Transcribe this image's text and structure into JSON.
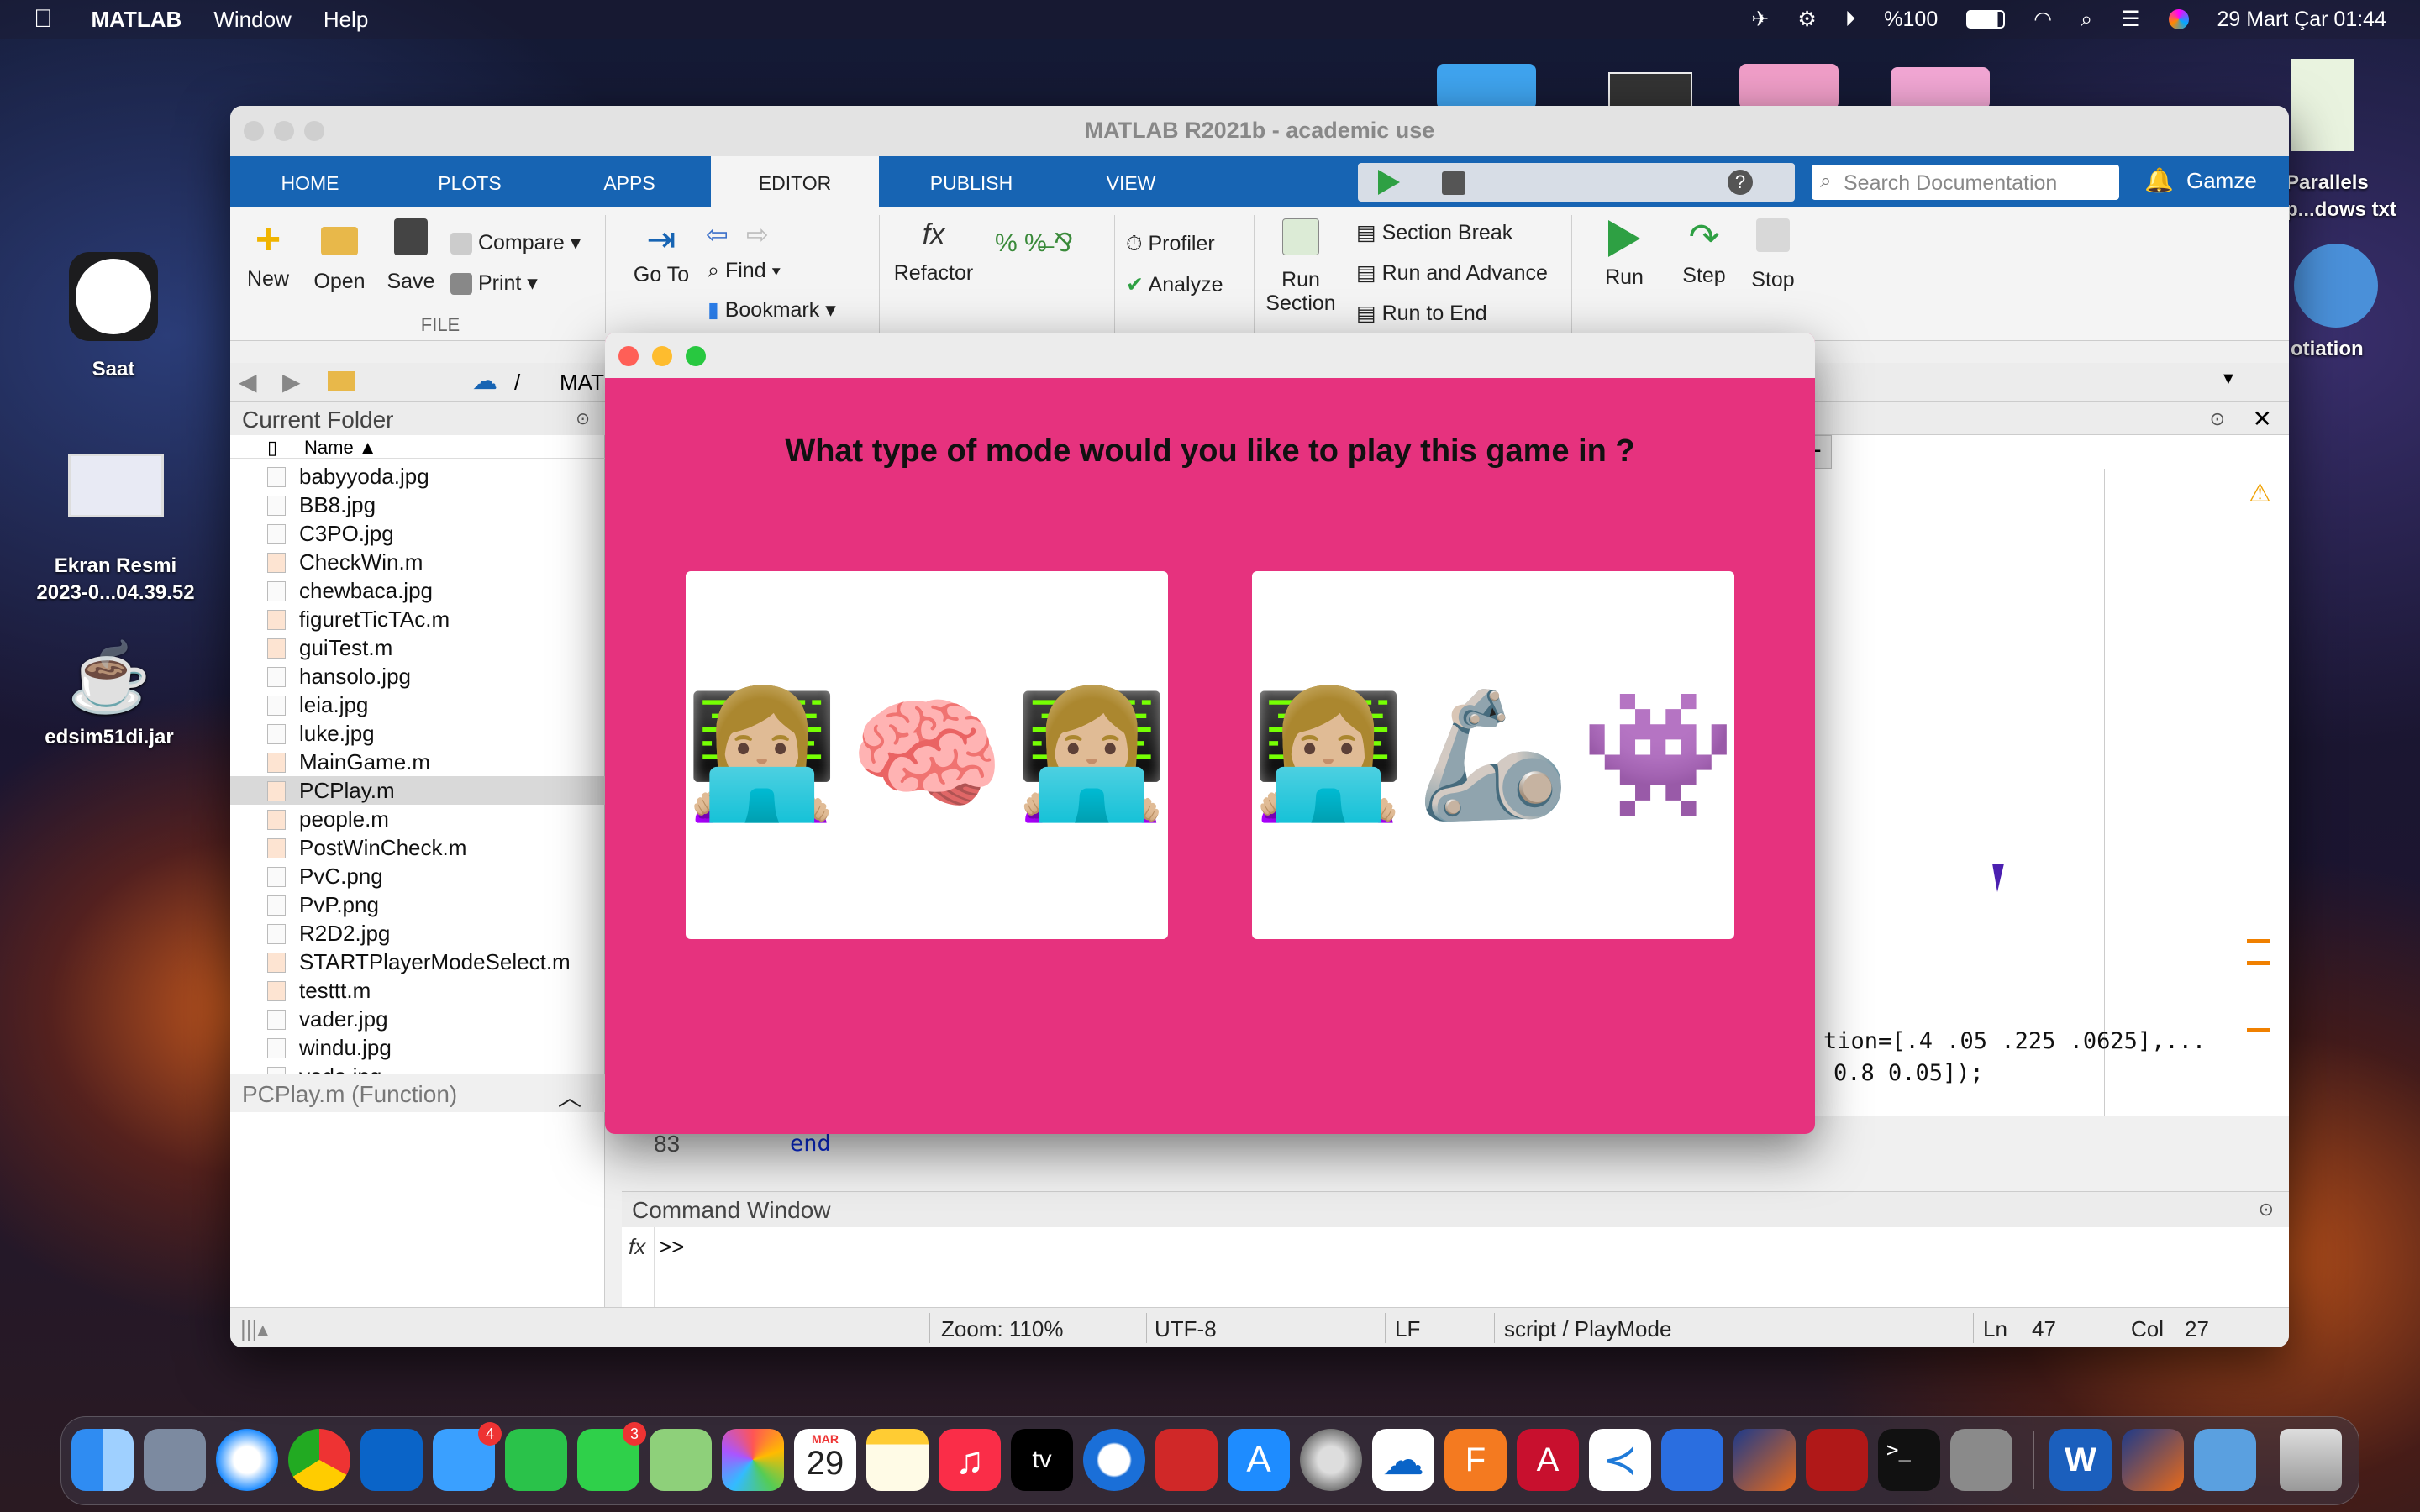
{
  "menubar": {
    "app": "MATLAB",
    "items": [
      "Window",
      "Help"
    ],
    "battery": "%100",
    "datetime": "29 Mart Çar 01:44"
  },
  "desktop": {
    "icons": [
      {
        "label": "Saat"
      },
      {
        "label": "Ekran Resmi\n2023-0...04.39.52"
      },
      {
        "label": "edsim51di.jar"
      },
      {
        "label": "Parallels\np...dows txt"
      },
      {
        "label": "otiation"
      }
    ]
  },
  "window": {
    "title": "MATLAB R2021b - academic use",
    "tabs": [
      "HOME",
      "PLOTS",
      "APPS",
      "EDITOR",
      "PUBLISH",
      "VIEW"
    ],
    "search_placeholder": "Search Documentation",
    "user": "Gamze",
    "ribbon": {
      "new": "New",
      "open": "Open",
      "save": "Save",
      "compare": "Compare",
      "print": "Print",
      "file_section": "FILE",
      "goto": "Go To",
      "find": "Find",
      "bookmark": "Bookmark",
      "refactor": "Refactor",
      "profiler": "Profiler",
      "analyze": "Analyze",
      "run_section": "Run\nSection",
      "section_break": "Section Break",
      "run_advance": "Run and Advance",
      "run_end": "Run to End",
      "run": "Run",
      "step": "Step",
      "stop": "Stop"
    },
    "path": {
      "sep": "/",
      "seg": "MAT"
    },
    "current_folder": {
      "title": "Current Folder",
      "name_header": "Name ▲",
      "files": [
        "babyyoda.jpg",
        "BB8.jpg",
        "C3PO.jpg",
        "CheckWin.m",
        "chewbaca.jpg",
        "figuretTicTAc.m",
        "guiTest.m",
        "hansolo.jpg",
        "leia.jpg",
        "luke.jpg",
        "MainGame.m",
        "PCPlay.m",
        "people.m",
        "PostWinCheck.m",
        "PvC.png",
        "PvP.png",
        "R2D2.jpg",
        "STARTPlayerModeSelect.m",
        "testtt.m",
        "vader.jpg",
        "windu.jpg",
        "yoda.jpg"
      ],
      "selected": "PCPlay.m",
      "footer": "PCPlay.m  (Function)"
    },
    "editor": {
      "code1": "tion=[.4 .05 .225 .0625],...",
      "code2": "0.8 0.05]);",
      "line_no": "83",
      "line_code": "end",
      "plus": "+"
    },
    "command": {
      "title": "Command Window",
      "fx": "fx",
      "prompt": ">>"
    },
    "status": {
      "zoom": "Zoom: 110%",
      "enc": "UTF-8",
      "eol": "LF",
      "ctx": "script / PlayMode",
      "ln_label": "Ln",
      "ln": "47",
      "col_label": "Col",
      "col": "27"
    }
  },
  "dialog": {
    "question": "What type of mode would you like to play this game in ?",
    "pvp": {
      "left": "👩🏼‍💻",
      "mid": "🧠",
      "right": "👩🏼‍💻"
    },
    "pvc": {
      "left": "👩🏼‍💻",
      "mid": "🦾",
      "right": "👾"
    }
  },
  "dock": {
    "calendar_month": "MAR",
    "calendar_day": "29",
    "mail_badge": "4",
    "messages_badge": "3",
    "tv": "tv"
  }
}
